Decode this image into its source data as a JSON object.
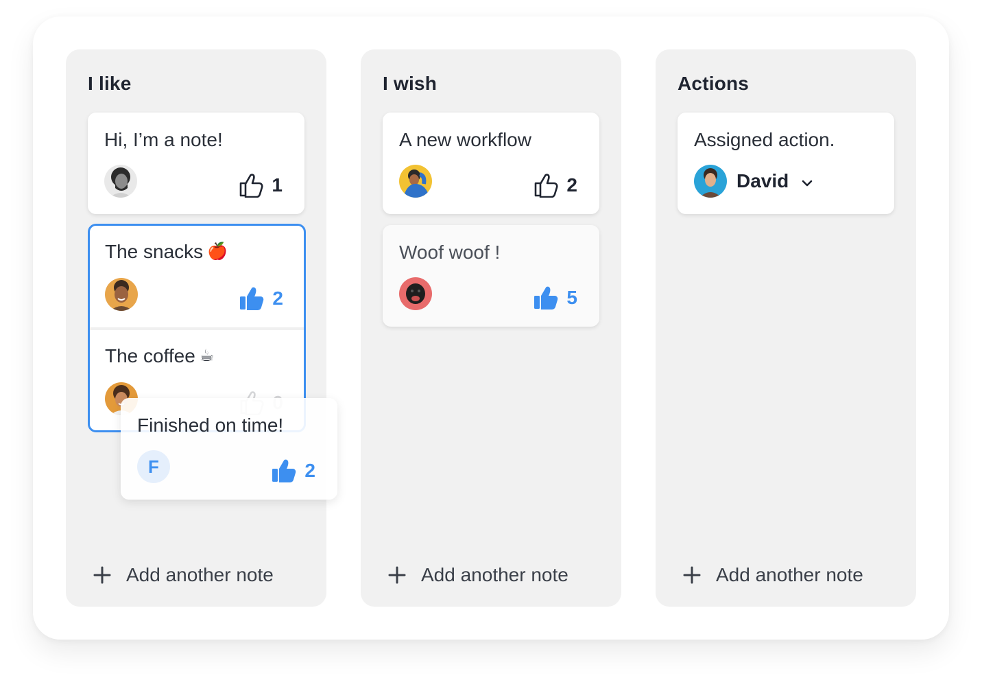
{
  "columns": [
    {
      "title": "I like",
      "notes": [
        {
          "text": "Hi, I’m a note!",
          "votes": "1"
        }
      ],
      "group": [
        {
          "text": "The snacks",
          "emoji": "🍎",
          "votes": "2"
        },
        {
          "text": "The coffee",
          "emoji": "☕",
          "votes": "0"
        }
      ],
      "add_label": "Add another note"
    },
    {
      "title": "I wish",
      "notes": [
        {
          "text": "A new workflow",
          "votes": "2"
        },
        {
          "text": "Woof woof !",
          "votes": "5"
        }
      ],
      "add_label": "Add another note"
    },
    {
      "title": "Actions",
      "notes": [
        {
          "text": "Assigned action.",
          "assignee": "David"
        }
      ],
      "add_label": "Add another note"
    }
  ],
  "dragging_note": {
    "text": "Finished on time!",
    "author_initial": "F",
    "votes": "2"
  },
  "colors": {
    "accent": "#3d8ff0",
    "column_bg": "#f1f1f1",
    "text": "#1f2430"
  },
  "icons": [
    "thumbs-up-outline-icon",
    "thumbs-up-filled-icon",
    "plus-icon",
    "chevron-down-icon"
  ]
}
